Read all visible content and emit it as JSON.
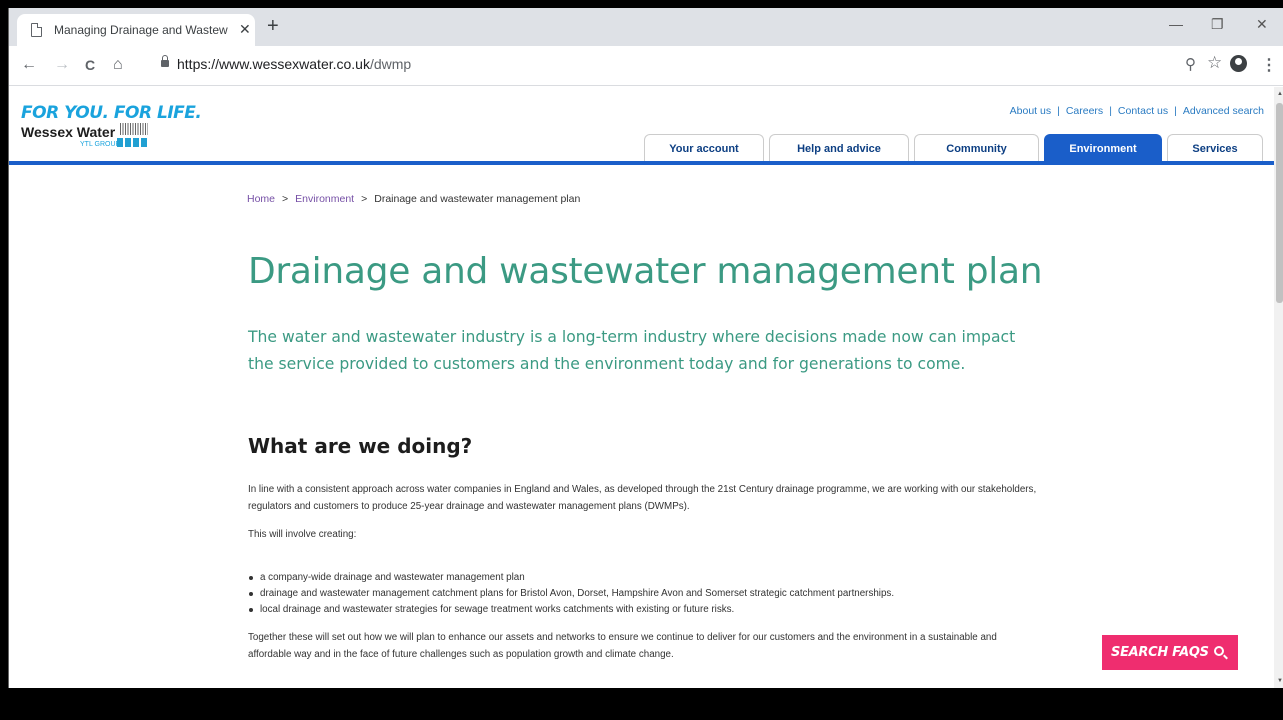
{
  "browser": {
    "tab_title": "Managing Drainage and Wastew",
    "new_tab": "+",
    "close_tab": "✕",
    "minimize": "—",
    "restore": "❐",
    "close_window": "✕",
    "back": "←",
    "forward": "→",
    "reload": "C",
    "home": "⌂",
    "url_host": "https://www.wessexwater.co.uk",
    "url_path": "/dwmp",
    "zoom_icon": "⚲",
    "star": "☆",
    "menu": "⋮"
  },
  "site": {
    "tagline": "FOR YOU. FOR LIFE.",
    "name": "Wessex Water",
    "group": "YTL GROUP",
    "top_links": [
      "About us",
      "Careers",
      "Contact us",
      "Advanced search"
    ],
    "nav_tabs": [
      "Your account",
      "Help and advice",
      "Community",
      "Environment",
      "Services"
    ],
    "active_tab": "Environment"
  },
  "breadcrumb": {
    "home": "Home",
    "section": "Environment",
    "current": "Drainage and wastewater management plan",
    "separator": ">"
  },
  "content": {
    "title": "Drainage and wastewater management plan",
    "lead": "The water and wastewater industry is a long-term industry where decisions made now can impact the service provided to customers and the environment today and for generations to come.",
    "heading": "What are we doing?",
    "para1": "In line with a consistent approach across water companies in England and Wales, as developed through the 21st Century drainage programme, we are working with our stakeholders, regulators and customers to produce 25-year drainage and wastewater management plans (DWMPs).",
    "para2": "This will involve creating:",
    "bullets": [
      "a company-wide drainage and wastewater management plan",
      "drainage and wastewater management catchment plans for Bristol Avon, Dorset, Hampshire Avon and Somerset strategic catchment partnerships.",
      "local drainage and wastewater strategies for sewage treatment works catchments with existing or future risks."
    ],
    "para3": "Together these will set out how we will plan to enhance our assets and networks to ensure we continue to deliver for our customers and the environment in a sustainable and affordable way and in the face of future challenges such as population growth and climate change."
  },
  "search_faqs": "SEARCH FAQS",
  "colors": {
    "accent_green": "#3b9a83",
    "brand_blue": "#1a5ec9",
    "faq_pink": "#ef2d6f",
    "logo_cyan": "#1aa3dd"
  }
}
